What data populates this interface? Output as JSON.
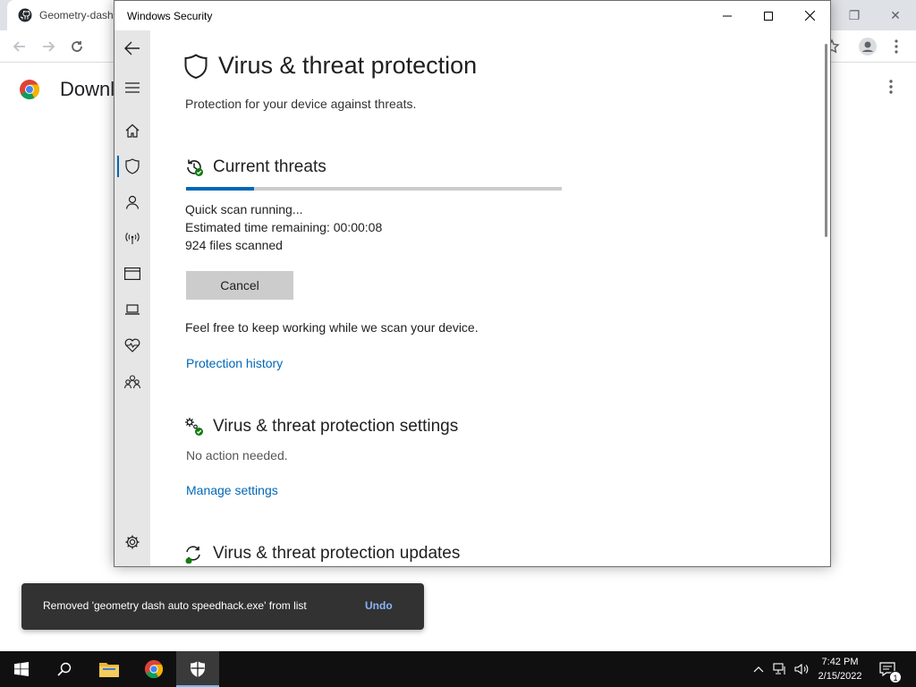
{
  "chrome": {
    "tab_title": "Geometry-dash",
    "page_title": "Downl",
    "icons": [
      "github-icon",
      "back-icon",
      "forward-icon",
      "reload-icon",
      "bookmark-star-icon",
      "profile-icon",
      "menu-icon"
    ]
  },
  "window": {
    "title": "Windows Security"
  },
  "nav": {
    "items": [
      "back",
      "hamburger",
      "home",
      "virus-protection",
      "account-protection",
      "firewall",
      "app-browser-control",
      "device-security",
      "device-performance",
      "family-options",
      "settings"
    ],
    "active": "virus-protection"
  },
  "page": {
    "title": "Virus & threat protection",
    "subtitle": "Protection for your device against threats."
  },
  "current_threats": {
    "heading": "Current threats",
    "progress": 0.18,
    "status": "Quick scan running...",
    "time_label": "Estimated time remaining:",
    "time_value": "00:00:08",
    "files_count": "924",
    "files_label": "files scanned",
    "cancel_label": "Cancel",
    "info": "Feel free to keep working while we scan your device.",
    "history_link": "Protection history"
  },
  "settings_section": {
    "heading": "Virus & threat protection settings",
    "status": "No action needed.",
    "link": "Manage settings"
  },
  "updates_section": {
    "heading": "Virus & threat protection updates"
  },
  "toast": {
    "message": "Removed 'geometry dash auto speedhack.exe' from list",
    "action": "Undo"
  },
  "taskbar": {
    "time": "7:42 PM",
    "date": "2/15/2022",
    "notifications": "1",
    "colors": {
      "background": "#101010",
      "accent": "#76b9ed"
    }
  },
  "colors": {
    "link": "#0067b8",
    "progress": "#0067b8",
    "nav_bg": "#e6e6e6"
  }
}
